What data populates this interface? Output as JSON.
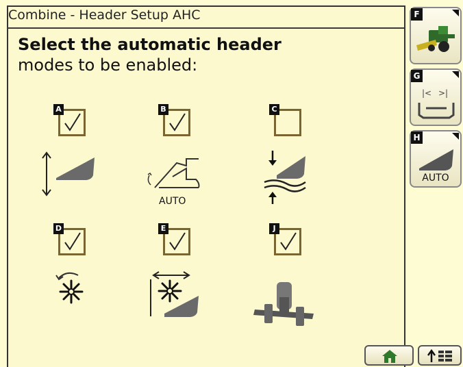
{
  "window": {
    "title": "Combine - Header Setup AHC"
  },
  "instructions": {
    "line1": "Select the automatic header",
    "line2": "modes to be enabled:"
  },
  "options": [
    {
      "tag": "A",
      "checked": true
    },
    {
      "tag": "B",
      "checked": true
    },
    {
      "tag": "C",
      "checked": false
    },
    {
      "tag": "D",
      "checked": true
    },
    {
      "tag": "E",
      "checked": true
    },
    {
      "tag": "J",
      "checked": true
    }
  ],
  "mode_icons": {
    "b_label": "AUTO"
  },
  "side_buttons": [
    {
      "tag": "F",
      "icon": "combine-icon"
    },
    {
      "tag": "G",
      "icon": "header-width-icon"
    },
    {
      "tag": "H",
      "icon": "auto-header-icon",
      "label": "AUTO"
    }
  ],
  "bottom_buttons": [
    {
      "icon": "home-icon"
    },
    {
      "icon": "menu-list-icon"
    }
  ],
  "colors": {
    "background": "#fefcd2",
    "checkbox_border": "#7a6530",
    "icon_gray": "#555555"
  }
}
